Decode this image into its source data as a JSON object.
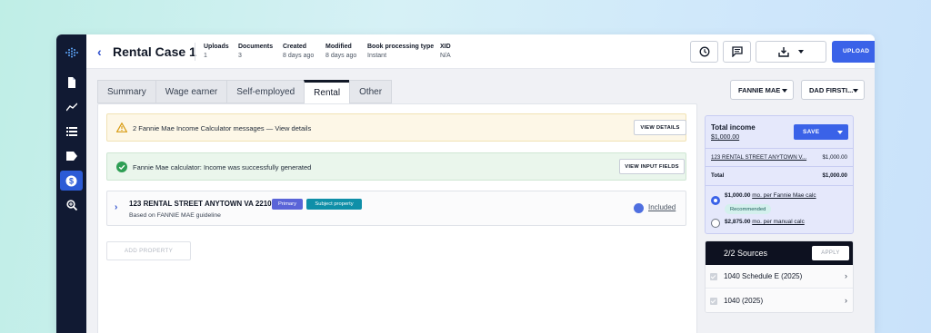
{
  "app": {
    "title": "Rental Case 1",
    "back_icon": "chevron-left-icon"
  },
  "meta": [
    {
      "label": "Uploads",
      "value": "1"
    },
    {
      "label": "Documents",
      "value": "3"
    },
    {
      "label": "Created",
      "value": "8 days ago"
    },
    {
      "label": "Modified",
      "value": "8 days ago"
    },
    {
      "label": "Book processing type",
      "value": "Instant"
    },
    {
      "label": "XID",
      "value": "N/A"
    }
  ],
  "toolbar": {
    "upload_label": "UPLOAD",
    "history_icon": "clock-history-icon",
    "comment_icon": "comment-icon",
    "download_icon": "download-icon"
  },
  "sidebar": {
    "items": [
      {
        "icon": "document-icon",
        "active": false
      },
      {
        "icon": "trend-line-icon",
        "active": false
      },
      {
        "icon": "list-icon",
        "active": false
      },
      {
        "icon": "tag-icon",
        "active": false
      },
      {
        "icon": "dollar-icon",
        "active": true
      },
      {
        "icon": "search-zoom-icon",
        "active": false
      }
    ]
  },
  "tabs": [
    "Summary",
    "Wage earner",
    "Self-employed",
    "Rental",
    "Other"
  ],
  "active_tab": "Rental",
  "dropdowns": {
    "agency": "FANNIE MAE",
    "borrower": "DAD FIRSTI..."
  },
  "alerts": {
    "warning_text": "2 Fannie Mae Income Calculator messages — View details",
    "warning_button": "VIEW DETAILS",
    "success_text": "Fannie Mae calculator: Income was successfully generated",
    "success_button": "VIEW INPUT FIELDS"
  },
  "property": {
    "address": "123 RENTAL STREET ANYTOWN VA 22107",
    "badge_primary": "Primary",
    "badge_subject": "Subject property",
    "guideline": "Based on FANNIE MAE guideline",
    "status": "Included"
  },
  "add_property_label": "ADD PROPERTY",
  "income": {
    "title": "Total income",
    "amount": "$1,000.00",
    "save_label": "SAVE",
    "row_label": "123 RENTAL STREET ANYTOWN V...",
    "row_value": "$1,000.00",
    "total_label": "Total",
    "total_value": "$1,000.00",
    "option1_amount": "$1,000.00",
    "option1_text": "mo. per Fannie Mae calc",
    "recommended": "Recommended",
    "option2_amount": "$2,875.00",
    "option2_text": "mo. per manual calc"
  },
  "sources": {
    "title": "2/2 Sources",
    "apply_label": "APPLY",
    "items": [
      {
        "label": "1040 Schedule E (2025)"
      },
      {
        "label": "1040 (2025)"
      }
    ]
  },
  "colors": {
    "accent": "#3a62e8",
    "rail": "#111a33",
    "warning_bg": "#fdf7e7",
    "success_bg": "#eaf6ec",
    "income_bg": "#e5e8fb"
  }
}
